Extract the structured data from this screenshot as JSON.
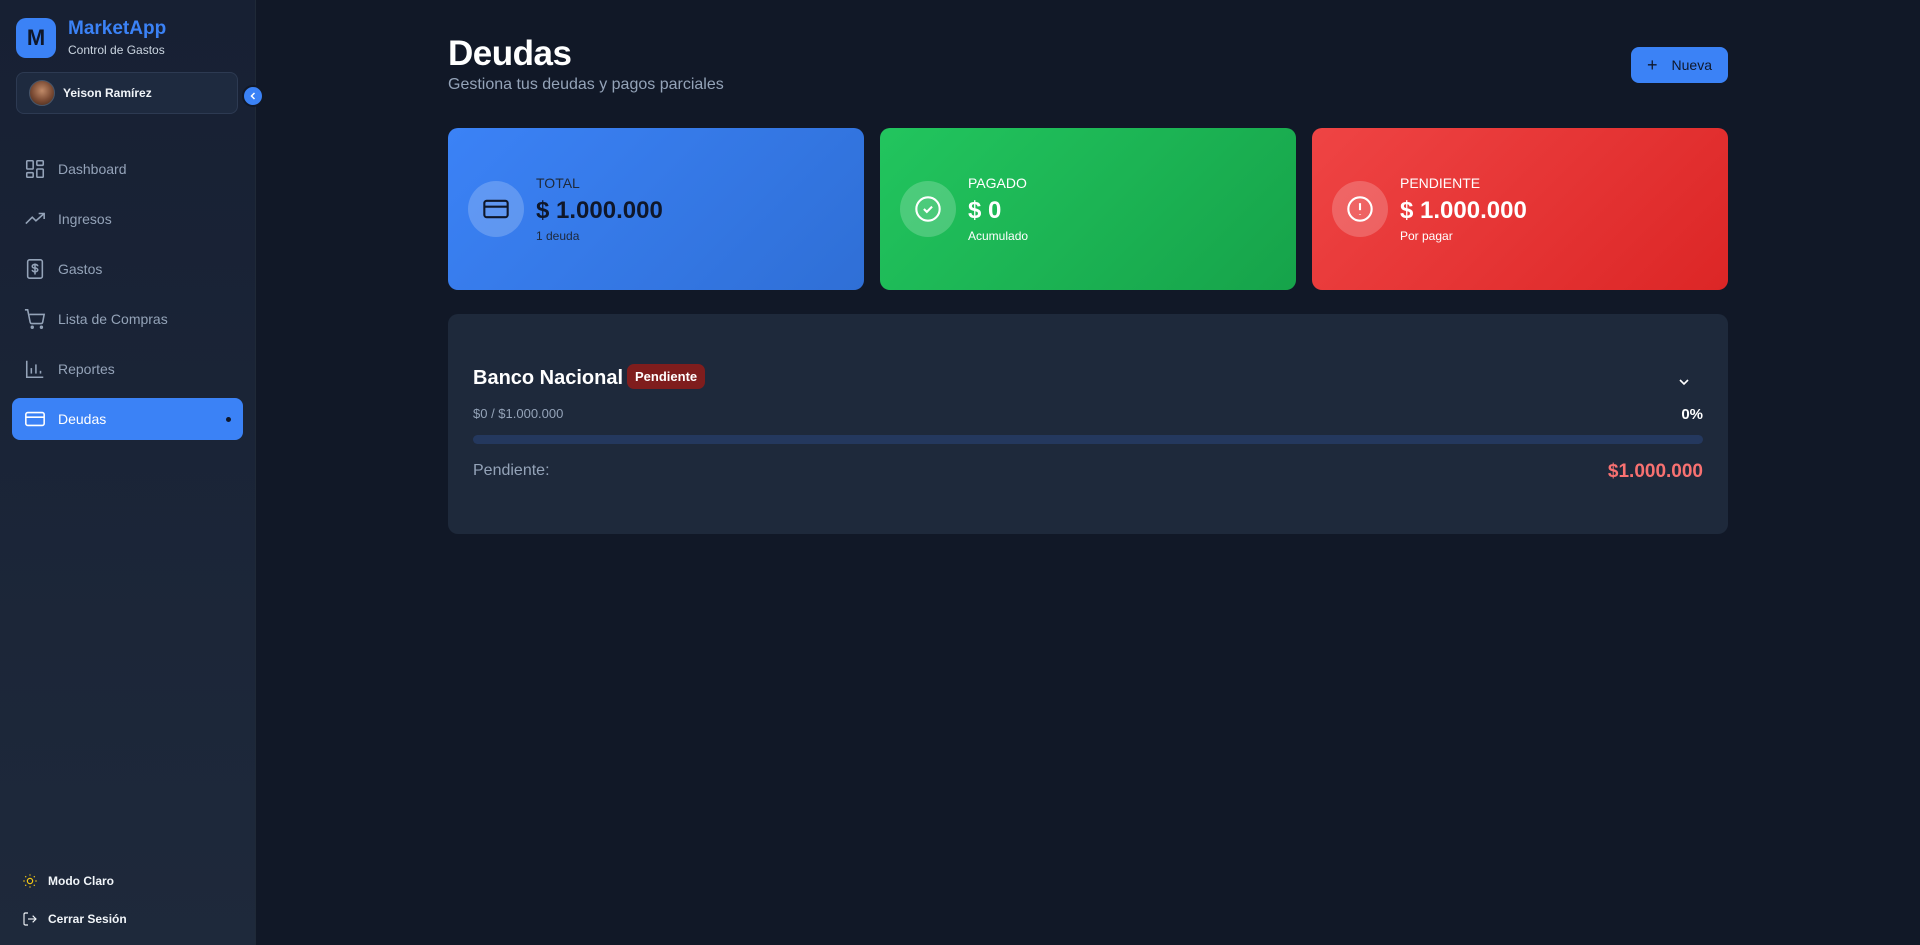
{
  "sidebar": {
    "brand_initial": "M",
    "brand_name": "MarketApp",
    "brand_subtitle": "Control de Gastos",
    "user_name": "Yeison Ramírez",
    "nav": [
      {
        "label": "Dashboard",
        "icon": "dashboard-icon",
        "active": false
      },
      {
        "label": "Ingresos",
        "icon": "trending-up-icon",
        "active": false
      },
      {
        "label": "Gastos",
        "icon": "dollar-receipt-icon",
        "active": false
      },
      {
        "label": "Lista de Compras",
        "icon": "cart-icon",
        "active": false
      },
      {
        "label": "Reportes",
        "icon": "bar-chart-icon",
        "active": false
      },
      {
        "label": "Deudas",
        "icon": "credit-card-icon",
        "active": true
      }
    ],
    "theme_toggle_label": "Modo Claro",
    "logout_label": "Cerrar Sesión"
  },
  "header": {
    "title": "Deudas",
    "subtitle": "Gestiona tus deudas y pagos parciales",
    "new_button_label": "Nueva"
  },
  "summary": {
    "total": {
      "label": "TOTAL",
      "value": "$ 1.000.000",
      "note": "1 deuda",
      "icon": "credit-card-icon"
    },
    "paid": {
      "label": "PAGADO",
      "value": "$ 0",
      "note": "Acumulado",
      "icon": "check-circle-icon"
    },
    "pending": {
      "label": "PENDIENTE",
      "value": "$ 1.000.000",
      "note": "Por pagar",
      "icon": "alert-circle-icon"
    }
  },
  "debts": [
    {
      "name": "Banco Nacional",
      "status": "Pendiente",
      "progress_text": "$0 / $1.000.000",
      "percent_label": "0%",
      "progress": 0,
      "pending_label": "Pendiente:",
      "pending_value": "$1.000.000"
    }
  ],
  "colors": {
    "accent": "#3b82f6",
    "success": "#22c55e",
    "danger": "#ef4444",
    "background": "#111827"
  }
}
